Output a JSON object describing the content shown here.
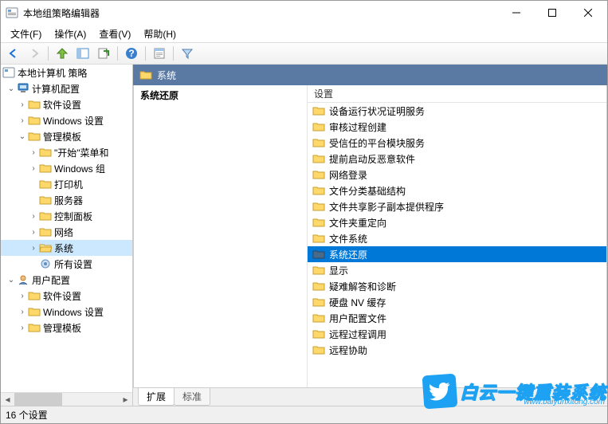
{
  "window": {
    "title": "本地组策略编辑器"
  },
  "menu": {
    "file": "文件(F)",
    "action": "操作(A)",
    "view": "查看(V)",
    "help": "帮助(H)"
  },
  "tree": {
    "root": "本地计算机 策略",
    "computer": "计算机配置",
    "cc_soft": "软件设置",
    "cc_win": "Windows 设置",
    "cc_admin": "管理模板",
    "cc_start": "\"开始\"菜单和",
    "cc_wincomp": "Windows 组",
    "cc_printer": "打印机",
    "cc_server": "服务器",
    "cc_ctrl": "控制面板",
    "cc_net": "网络",
    "cc_system": "系统",
    "cc_all": "所有设置",
    "user": "用户配置",
    "uc_soft": "软件设置",
    "uc_win": "Windows 设置",
    "uc_admin": "管理模板"
  },
  "header": {
    "title": "系统"
  },
  "desc": {
    "title": "系统还原"
  },
  "list": {
    "column": "设置",
    "items": [
      "设备运行状况证明服务",
      "审核过程创建",
      "受信任的平台模块服务",
      "提前启动反恶意软件",
      "网络登录",
      "文件分类基础结构",
      "文件共享影子副本提供程序",
      "文件夹重定向",
      "文件系统",
      "系统还原",
      "显示",
      "疑难解答和诊断",
      "硬盘 NV 缓存",
      "用户配置文件",
      "远程过程调用",
      "远程协助"
    ],
    "selected_index": 9
  },
  "tabs": {
    "extended": "扩展",
    "standard": "标准"
  },
  "status": {
    "text": "16 个设置"
  },
  "watermark": {
    "text": "白云一键重装系统",
    "url": "www.baiyunxitong.com"
  }
}
